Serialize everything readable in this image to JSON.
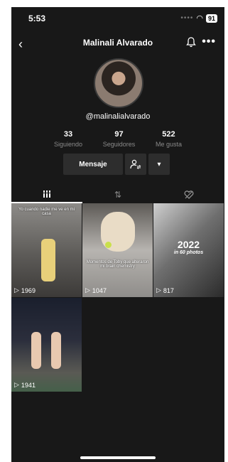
{
  "status": {
    "time": "5:53",
    "battery": "91"
  },
  "nav": {
    "title": "Malinali Alvarado"
  },
  "profile": {
    "handle": "@malinalialvarado"
  },
  "stats": [
    {
      "value": "33",
      "label": "Siguiendo"
    },
    {
      "value": "97",
      "label": "Seguidores"
    },
    {
      "value": "522",
      "label": "Me gusta"
    }
  ],
  "actions": {
    "message_label": "Mensaje"
  },
  "videos": [
    {
      "caption": "Yo cuando nadie me ve en mi casa",
      "plays": "1969"
    },
    {
      "caption": "Momentos de Toby que alteraron mi brain chemistry",
      "plays": "1047"
    },
    {
      "title": "2022",
      "subtitle": "in 60 photos",
      "plays": "817"
    },
    {
      "plays": "1941"
    }
  ]
}
